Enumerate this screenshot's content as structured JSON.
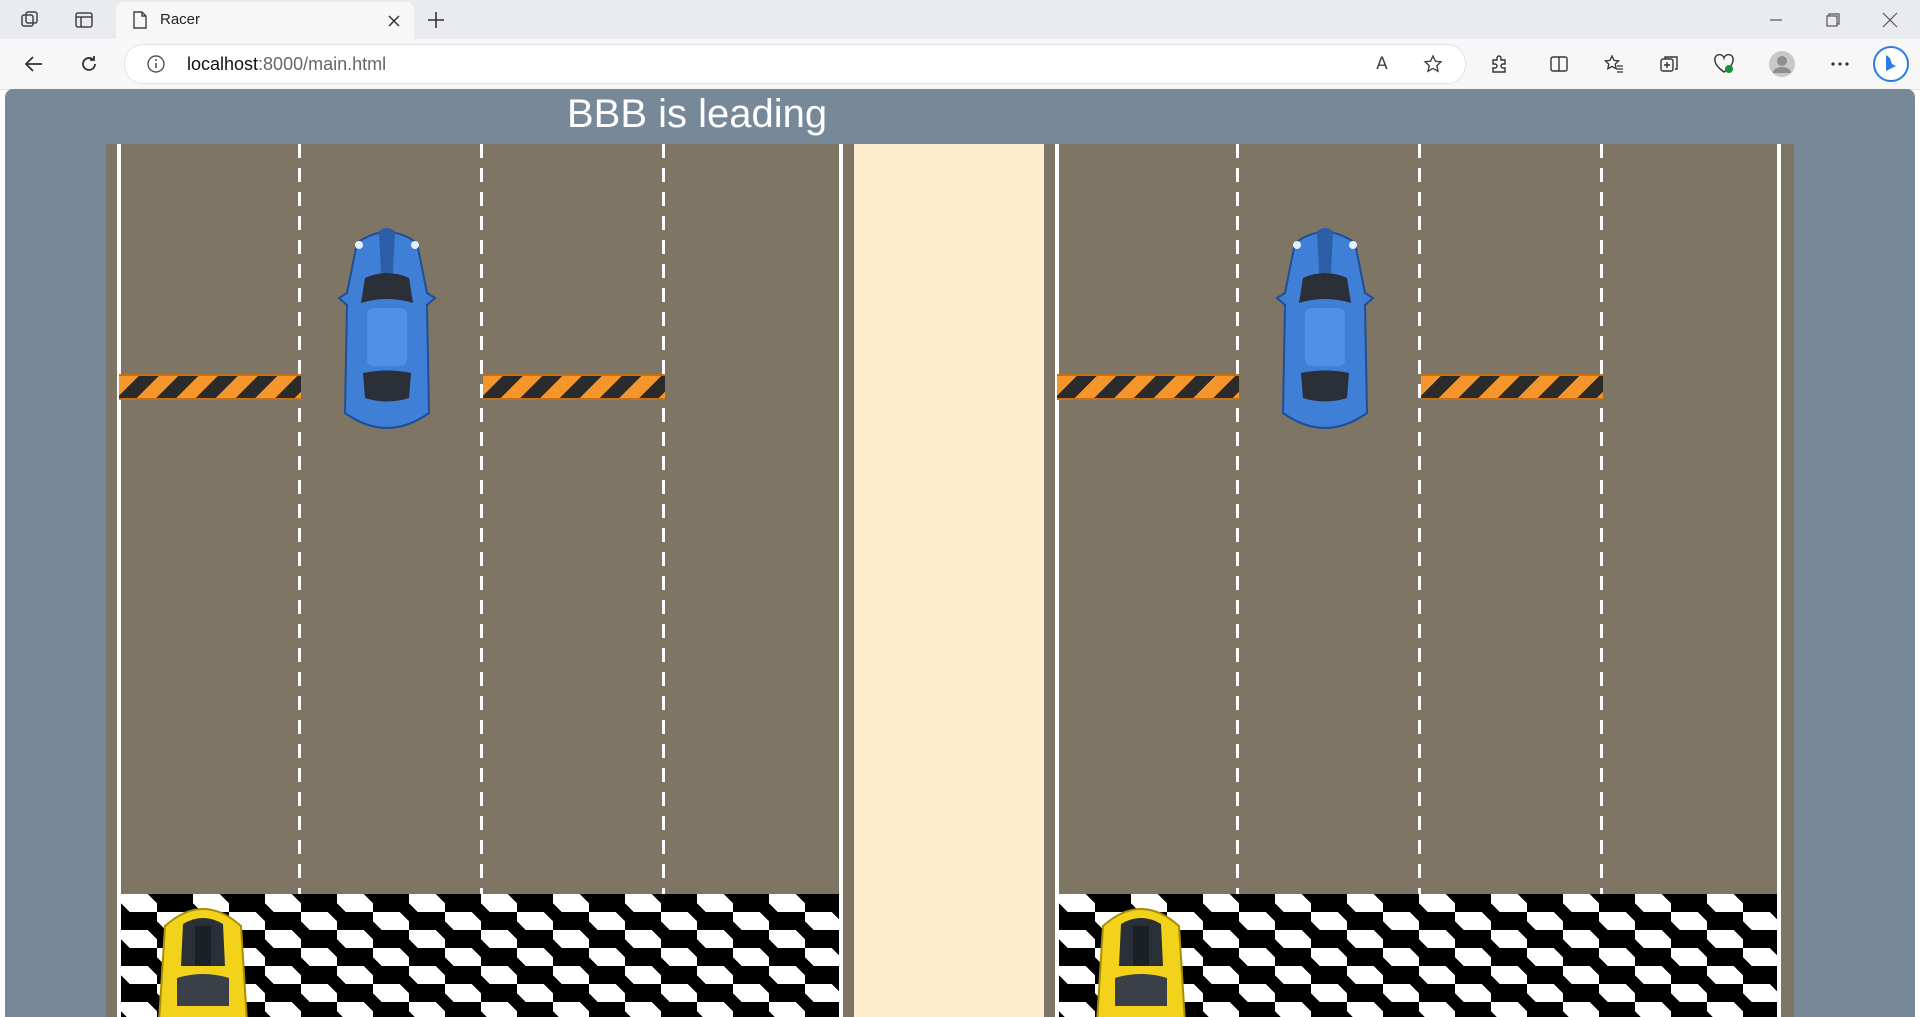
{
  "browser": {
    "tab_title": "Racer",
    "url_host": "localhost",
    "url_path": ":8000/main.html",
    "icons": [
      "workspaces-icon",
      "tab-actions-icon",
      "page-icon",
      "close-tab-icon",
      "new-tab-icon",
      "back-icon",
      "refresh-icon",
      "site-info-icon",
      "read-aloud-icon",
      "favorite-star-icon",
      "extensions-icon",
      "split-screen-icon",
      "favorites-icon",
      "collections-icon",
      "browser-essentials-icon",
      "profile-avatar-icon",
      "more-menu-icon",
      "copilot-icon",
      "minimize-icon",
      "restore-icon",
      "close-window-icon"
    ]
  },
  "game": {
    "status": "BBB is leading",
    "colors": {
      "background": "#778899",
      "road": "#7f7565",
      "median": "#ffebcd",
      "opponent_car": "#3f7fd6",
      "player_car": "#f2d21a",
      "barrier_orange": "#f5962c",
      "barrier_dark": "#2b2b2b"
    },
    "tracks": [
      {
        "lanes": 4,
        "barrier_lanes": [
          1,
          3
        ],
        "opponent_lane": 2,
        "player_lane": 1
      },
      {
        "lanes": 4,
        "barrier_lanes": [
          1,
          3
        ],
        "opponent_lane": 2,
        "player_lane": 1
      }
    ]
  }
}
